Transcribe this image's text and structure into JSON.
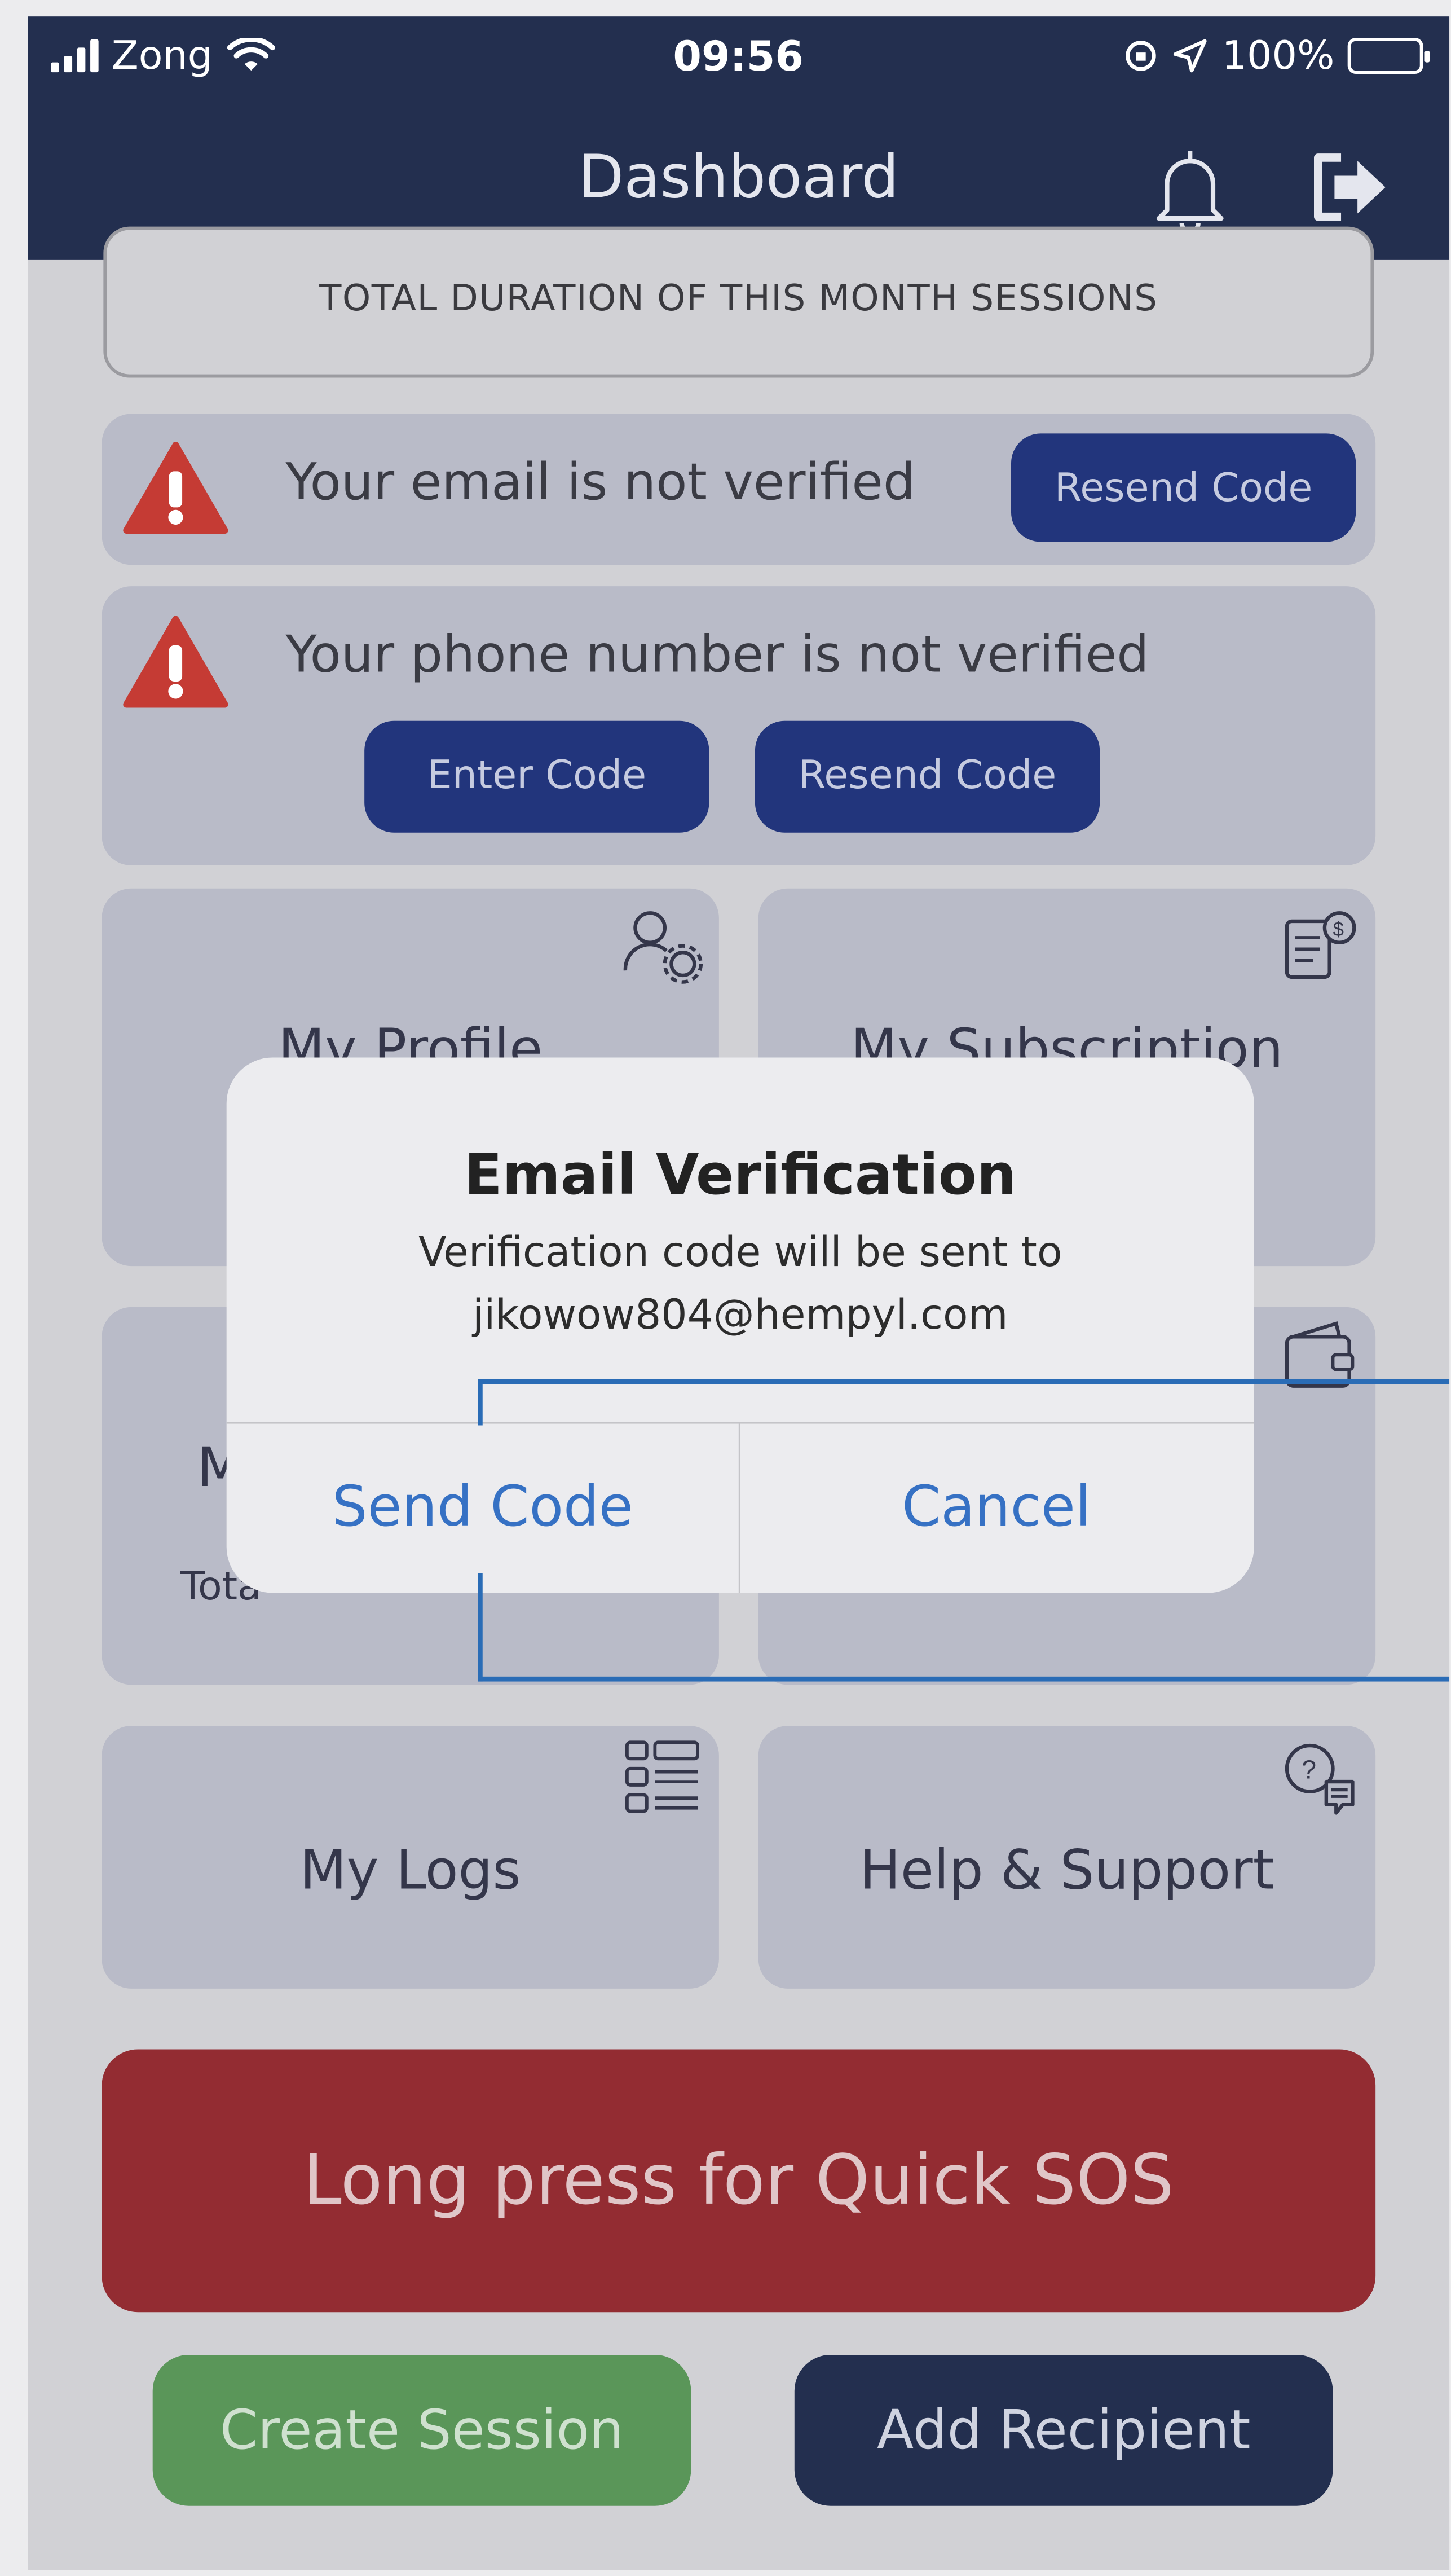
{
  "status_bar": {
    "carrier": "Zong",
    "time": "09:56",
    "battery": "100%"
  },
  "header": {
    "title": "Dashboard"
  },
  "summary": {
    "duration_label": "TOTAL DURATION OF THIS MONTH SESSIONS"
  },
  "email_alert": {
    "text": "Your email is not verified",
    "resend_label": "Resend Code"
  },
  "phone_alert": {
    "text": "Your phone number is not verified",
    "enter_label": "Enter Code",
    "resend_label": "Resend Code"
  },
  "tiles": {
    "profile": "My Profile",
    "subscription": "My Subscription",
    "recipients_partial": "M",
    "recipients_sub_partial": "Tota",
    "credit_partial": "",
    "logs": "My Logs",
    "help": "Help & Support"
  },
  "sos": {
    "label": "Long press for Quick SOS"
  },
  "actions": {
    "create_session": "Create Session",
    "add_recipient": "Add Recipient"
  },
  "dialog": {
    "title": "Email Verification",
    "message_line1": "Verification code will be sent to",
    "message_line2": "jikowow804@hempyl.com",
    "confirm_label": "Send Code",
    "cancel_label": "Cancel"
  },
  "colors": {
    "header_bg": "#232f4f",
    "sos_bg": "#932c32",
    "create_bg": "#5a9659",
    "navy_button": "#22357c",
    "dialog_button_text": "#3671c4",
    "annotation_line": "#2a6cb6"
  }
}
